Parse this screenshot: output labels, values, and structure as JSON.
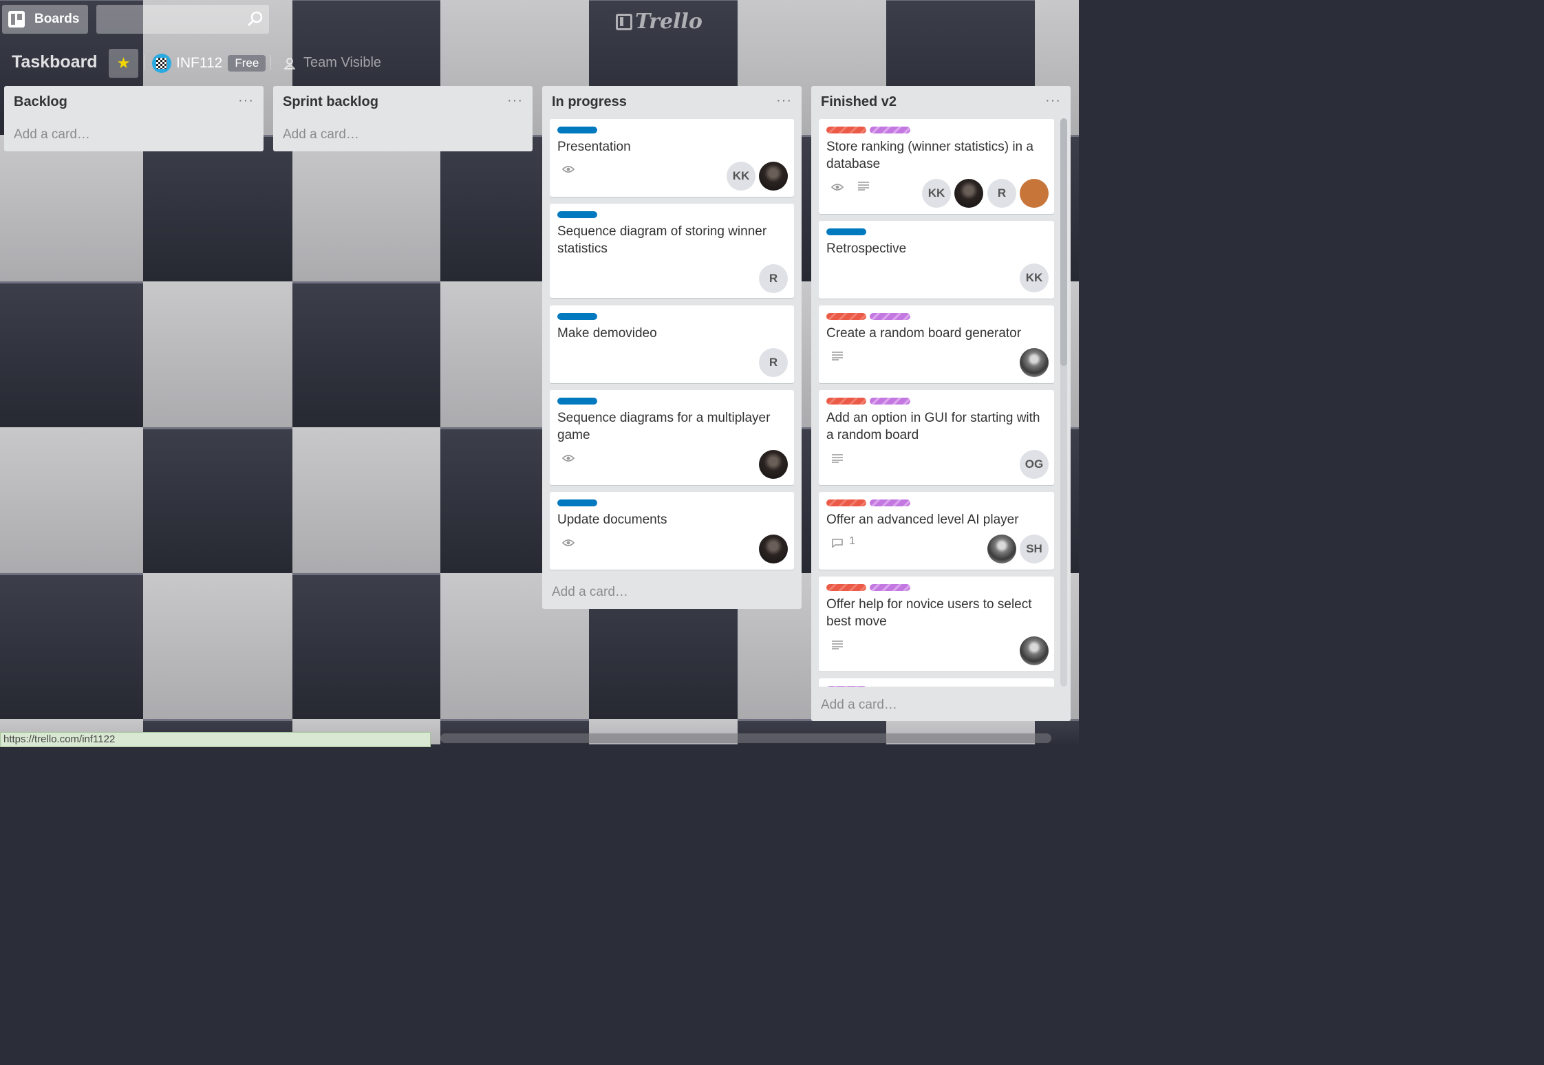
{
  "header": {
    "boards_label": "Boards",
    "search_placeholder": "",
    "logo_text": "Trello"
  },
  "board": {
    "title": "Taskboard",
    "team_name": "INF112",
    "team_plan": "Free",
    "visibility": "Team Visible",
    "star_color": "#f2d600"
  },
  "lists": [
    {
      "title": "Backlog",
      "menu": "···",
      "add_card": "Add a card…",
      "cards": []
    },
    {
      "title": "Sprint backlog",
      "menu": "···",
      "add_card": "Add a card…",
      "cards": []
    },
    {
      "title": "In progress",
      "menu": "···",
      "add_card": "Add a card…",
      "cards": [
        {
          "title": "Presentation",
          "labels": [
            "blue"
          ],
          "badges": [
            "eye-icon"
          ],
          "members": [
            "KK",
            "photo"
          ]
        },
        {
          "title": "Sequence diagram of storing winner statistics",
          "labels": [
            "blue"
          ],
          "badges": [],
          "members": [
            "R"
          ]
        },
        {
          "title": "Make demovideo",
          "labels": [
            "blue"
          ],
          "badges": [],
          "members": [
            "R"
          ]
        },
        {
          "title": "Sequence diagrams for a multiplayer game",
          "labels": [
            "blue"
          ],
          "badges": [
            "eye-icon"
          ],
          "members": [
            "photo"
          ]
        },
        {
          "title": "Update documents",
          "labels": [
            "blue"
          ],
          "badges": [
            "eye-icon"
          ],
          "members": [
            "photo"
          ]
        }
      ]
    },
    {
      "title": "Finished v2",
      "menu": "···",
      "add_card": "Add a card…",
      "cards": [
        {
          "title": "Store ranking (winner statistics) in a database",
          "labels": [
            "red",
            "purple"
          ],
          "badges": [
            "eye-icon",
            "description-icon"
          ],
          "members": [
            "KK",
            "photo",
            "R",
            "cartoon"
          ]
        },
        {
          "title": "Retrospective",
          "labels": [
            "blue"
          ],
          "badges": [],
          "members": [
            "KK"
          ]
        },
        {
          "title": "Create a random board generator",
          "labels": [
            "red",
            "purple"
          ],
          "badges": [
            "description-icon"
          ],
          "members": [
            "beard"
          ]
        },
        {
          "title": "Add an option in GUI for starting with a random board",
          "labels": [
            "red",
            "purple"
          ],
          "badges": [
            "description-icon"
          ],
          "members": [
            "OG"
          ]
        },
        {
          "title": "Offer an advanced level AI player",
          "labels": [
            "red",
            "purple"
          ],
          "badges": [
            "comment-icon"
          ],
          "comment_count": "1",
          "members": [
            "beard",
            "SH"
          ]
        },
        {
          "title": "Offer help for novice users to select best move",
          "labels": [
            "red",
            "purple"
          ],
          "badges": [
            "description-icon"
          ],
          "members": [
            "beard"
          ]
        }
      ]
    }
  ],
  "colors": {
    "blue_label": "#0079bf",
    "red_label": "#eb5a46",
    "purple_label": "#c377e0"
  },
  "status_bar": {
    "url": "https://trello.com/inf1122"
  }
}
